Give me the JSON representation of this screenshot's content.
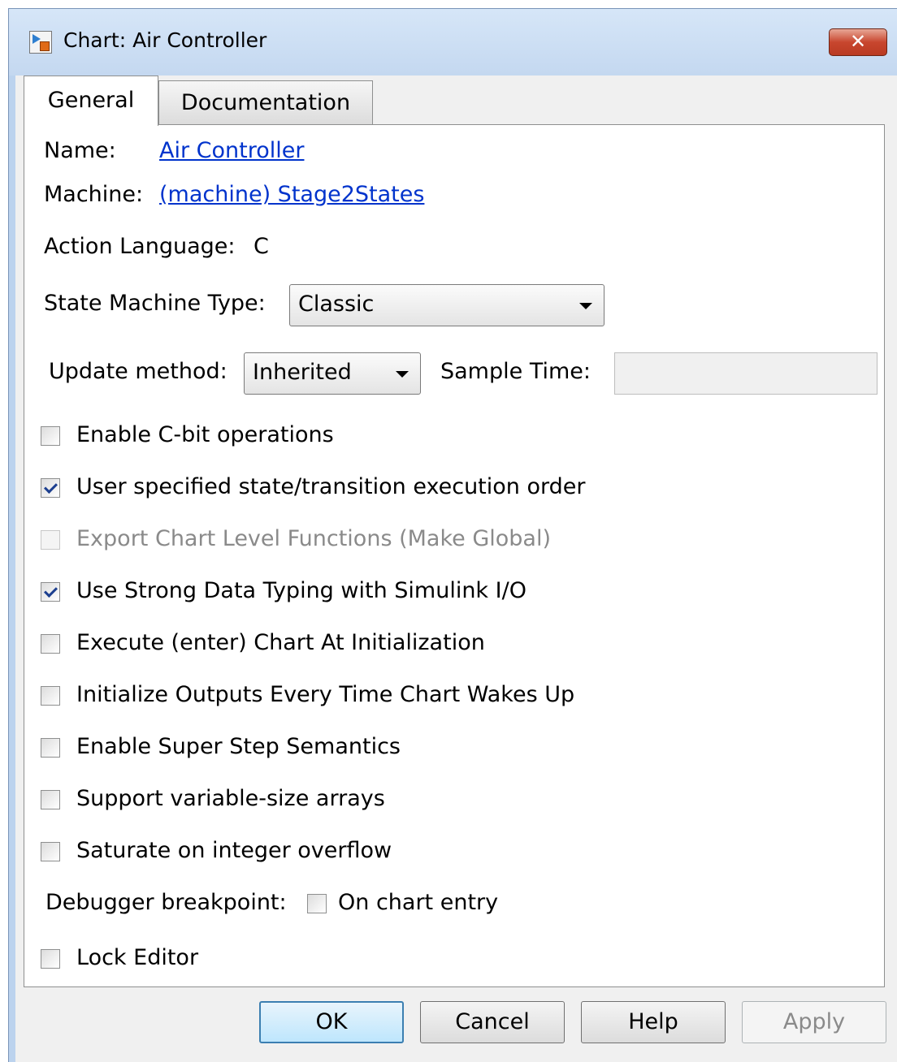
{
  "window": {
    "title": "Chart: Air Controller",
    "close_symbol": "✕"
  },
  "tabs": [
    {
      "label": "General",
      "selected": true
    },
    {
      "label": "Documentation",
      "selected": false
    }
  ],
  "general": {
    "name_label": "Name:",
    "name_value": "Air Controller",
    "machine_label": "Machine:",
    "machine_value": "(machine) Stage2States",
    "action_language_label": "Action Language:",
    "action_language_value": "C",
    "state_machine_type_label": "State Machine Type:",
    "state_machine_type_value": "Classic",
    "update_method_label": "Update method:",
    "update_method_value": "Inherited",
    "sample_time_label": "Sample Time:",
    "sample_time_value": ""
  },
  "checkboxes": [
    {
      "label": "Enable C-bit operations",
      "checked": false,
      "enabled": true
    },
    {
      "label": "User specified state/transition execution order",
      "checked": true,
      "enabled": true
    },
    {
      "label": "Export Chart Level Functions (Make Global)",
      "checked": false,
      "enabled": false
    },
    {
      "label": "Use Strong Data Typing with Simulink I/O",
      "checked": true,
      "enabled": true
    },
    {
      "label": "Execute (enter) Chart At Initialization",
      "checked": false,
      "enabled": true
    },
    {
      "label": "Initialize Outputs Every Time Chart Wakes Up",
      "checked": false,
      "enabled": true
    },
    {
      "label": "Enable Super Step Semantics",
      "checked": false,
      "enabled": true
    },
    {
      "label": "Support variable-size arrays",
      "checked": false,
      "enabled": true
    },
    {
      "label": "Saturate on integer overflow",
      "checked": false,
      "enabled": true
    }
  ],
  "debugger": {
    "label": "Debugger breakpoint:",
    "on_chart_entry_label": "On chart entry",
    "on_chart_entry_checked": false
  },
  "lock_editor": {
    "label": "Lock Editor",
    "checked": false
  },
  "buttons": {
    "ok": "OK",
    "cancel": "Cancel",
    "help": "Help",
    "apply": "Apply"
  }
}
